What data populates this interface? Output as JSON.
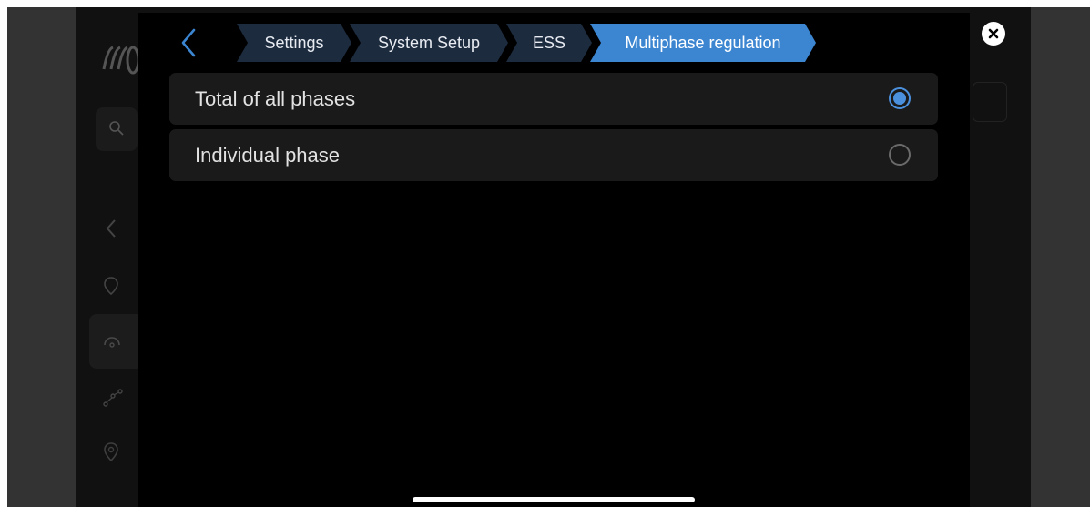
{
  "header": {
    "breadcrumbs": [
      {
        "label": "Settings"
      },
      {
        "label": "System Setup"
      },
      {
        "label": "ESS"
      },
      {
        "label": "Multiphase regulation",
        "active": true
      }
    ]
  },
  "options": [
    {
      "label": "Total of all phases",
      "selected": true
    },
    {
      "label": "Individual phase",
      "selected": false
    }
  ],
  "colors": {
    "accent": "#3b85d1",
    "crumb_bg": "#1d2b3f",
    "panel_bg": "#000000",
    "row_bg": "#1a1a1a"
  },
  "icons": {
    "back": "chevron-left-icon",
    "close": "close-icon",
    "background": [
      "victron-logo-icon",
      "search-icon",
      "chevron-left-icon",
      "location-icon",
      "gauge-icon",
      "graph-icon",
      "map-pin-icon"
    ]
  }
}
